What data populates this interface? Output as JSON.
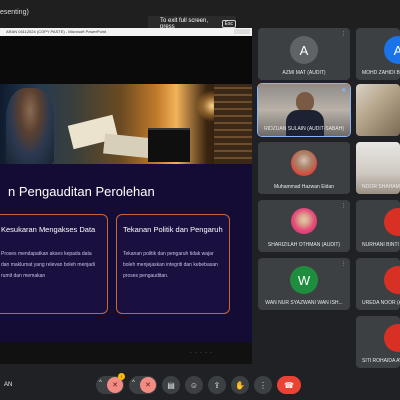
{
  "window": {
    "title_fragment": "esenting)",
    "exit_tip": "To exit full screen, press",
    "exit_key": "Esc"
  },
  "powerpoint": {
    "titlebar": "ARAN 04112024 (COPY PASTE) - Microsoft PowerPoint"
  },
  "slide": {
    "heading": "n Pengauditan Perolehan",
    "card1": {
      "title": "Kesukaran Mengakses Data",
      "body": "Proses mendapatkan akses kepada data dan maklumat yang relevan boleh menjadi rumit dan memakan"
    },
    "card2": {
      "title": "Tekanan Politik dan Pengaruh",
      "body": "Tekanan politik dan pengaruh tidak wajar boleh menjejaskan integriti dan kebebasan proses pengauditan."
    }
  },
  "presenter": {
    "name": "AN"
  },
  "controls": {
    "caret": "^",
    "mic_icon": "mic-off-icon",
    "cam_icon": "camera-off-icon",
    "cc_icon": "captions-icon",
    "emoji_icon": "emoji-icon",
    "present_icon": "present-icon",
    "hand_icon": "raise-hand-icon",
    "end_icon": "end-call-icon",
    "glyphs": {
      "mic": "✕",
      "cam": "✕",
      "cc": "▤",
      "emoji": "☺",
      "present": "⇪",
      "hand": "✋",
      "end": "☎"
    }
  },
  "participants": [
    {
      "name": "AZMI MAT (AUDIT)",
      "initial": "A",
      "avatar_color": "#5f6368"
    },
    {
      "name": "MOHD ZAHIDI B",
      "initial": "A",
      "avatar_color": "#1a73e8"
    },
    {
      "name": "RIDZUAN SULAIN (AUDIT-SABAH)",
      "initial": "",
      "avatar_color": ""
    },
    {
      "name": "",
      "initial": "",
      "avatar_color": ""
    },
    {
      "name": "Muhammad Hazwan Eidan",
      "initial": "",
      "avatar_color": ""
    },
    {
      "name": "NOOR SHAHAM",
      "initial": "",
      "avatar_color": ""
    },
    {
      "name": "SHARIZILAH OTHMAN (AUDIT)",
      "initial": "",
      "avatar_color": ""
    },
    {
      "name": "NURHANI BINTI",
      "initial": "",
      "avatar_color": ""
    },
    {
      "name": "WAN NUR SYAZWANI WAN ISH...",
      "initial": "W",
      "avatar_color": "#1e8e3e"
    },
    {
      "name": "UREDA NOOR (A",
      "initial": "",
      "avatar_color": ""
    },
    {
      "name": "SITI ROHAIDA AW",
      "initial": "",
      "avatar_color": ""
    }
  ],
  "accent_colors": {
    "mute_red": "#ea4335",
    "speaking_blue": "#8ab4f8",
    "card_border": "#c7653f"
  }
}
